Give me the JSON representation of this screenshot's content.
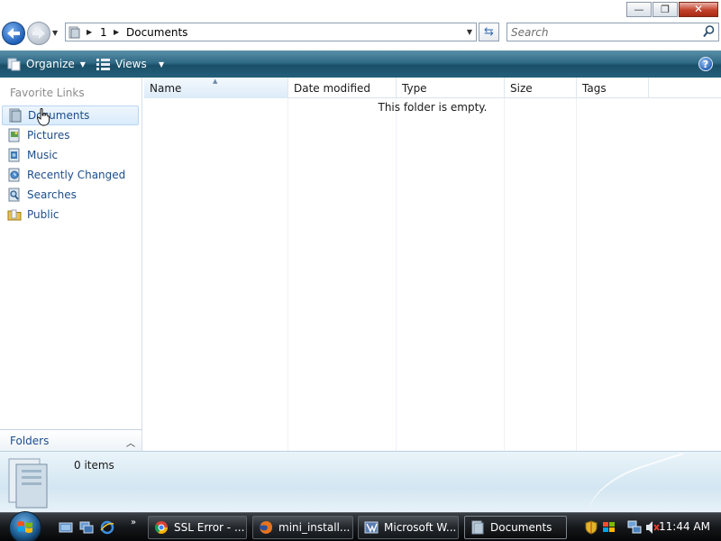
{
  "window": {
    "minimize_glyph": "—",
    "maximize_glyph": "❐",
    "close_glyph": "✕"
  },
  "address": {
    "crumbs": [
      "1",
      "Documents"
    ],
    "search_placeholder": "Search"
  },
  "commandbar": {
    "organize_label": "Organize",
    "views_label": "Views",
    "help_glyph": "?"
  },
  "navpane": {
    "header": "Favorite Links",
    "items": [
      {
        "label": "Documents",
        "icon": "documents-icon",
        "selected": true
      },
      {
        "label": "Pictures",
        "icon": "pictures-icon"
      },
      {
        "label": "Music",
        "icon": "music-icon"
      },
      {
        "label": "Recently Changed",
        "icon": "recently-changed-icon"
      },
      {
        "label": "Searches",
        "icon": "searches-icon"
      },
      {
        "label": "Public",
        "icon": "public-folder-icon"
      }
    ],
    "folders_label": "Folders"
  },
  "filelist": {
    "columns": [
      "Name",
      "Date modified",
      "Type",
      "Size",
      "Tags"
    ],
    "sorted_column": "Name",
    "empty_message": "This folder is empty."
  },
  "details": {
    "item_count": "0 items"
  },
  "taskbar": {
    "buttons": [
      {
        "label": "SSL Error - ...",
        "icon": "chrome-icon"
      },
      {
        "label": "mini_install...",
        "icon": "firefox-icon"
      },
      {
        "label": "Microsoft W...",
        "icon": "visual-studio-icon"
      },
      {
        "label": "Documents",
        "icon": "folder-icon",
        "active": true
      }
    ],
    "quick_launch_more": "»",
    "clock": "11:44 AM"
  },
  "colors": {
    "commandbar": "#2f6a86",
    "link": "#1d4e89",
    "selection": "#d9ebfb",
    "taskbar": "#15181b"
  }
}
